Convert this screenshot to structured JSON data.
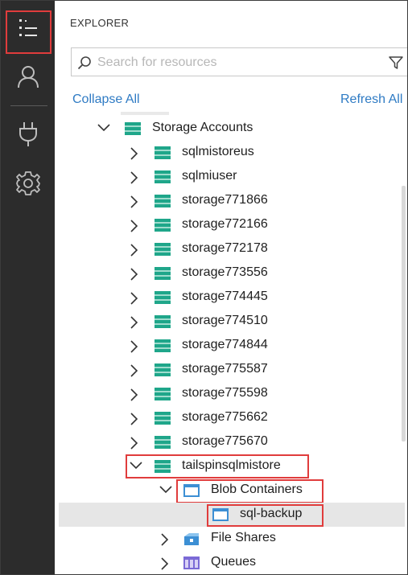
{
  "panel": {
    "title": "EXPLORER",
    "search_placeholder": "Search for resources",
    "collapse_all": "Collapse All",
    "refresh_all": "Refresh All"
  },
  "activity_bar": {
    "icons": [
      "explorer-list-icon",
      "account-icon",
      "plug-icon",
      "gear-icon"
    ]
  },
  "tree": {
    "storage_accounts": "Storage Accounts",
    "accounts": [
      "sqlmistoreus",
      "sqlmiuser",
      "storage771866",
      "storage772166",
      "storage772178",
      "storage773556",
      "storage774445",
      "storage774510",
      "storage774844",
      "storage775587",
      "storage775598",
      "storage775662",
      "storage775670"
    ],
    "expanded_account": "tailspinsqlmistore",
    "blob_containers": "Blob Containers",
    "selected_container": "sql-backup",
    "file_shares": "File Shares",
    "queues": "Queues"
  },
  "colors": {
    "activity_bar": "#2c2c2c",
    "highlight": "#e03c3c",
    "link": "#2f7bc4",
    "storage_icon": "#1fa68a",
    "container_icon": "#3c8fd4",
    "queue_icon": "#7b6ad6"
  }
}
